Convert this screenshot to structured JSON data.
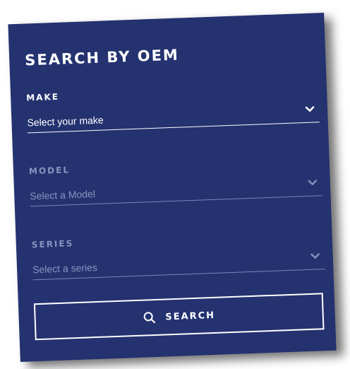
{
  "panel": {
    "title": "SEARCH BY OEM",
    "background_color": "#243270",
    "disabled_color": "#8a93bf"
  },
  "fields": [
    {
      "label": "MAKE",
      "placeholder": "Select your make",
      "enabled": true
    },
    {
      "label": "MODEL",
      "placeholder": "Select a Model",
      "enabled": false
    },
    {
      "label": "SERIES",
      "placeholder": "Select a series",
      "enabled": false
    }
  ],
  "search_button": {
    "label": "SEARCH",
    "icon": "search-icon"
  },
  "icons": {
    "dropdown": "chevron-down-icon"
  }
}
